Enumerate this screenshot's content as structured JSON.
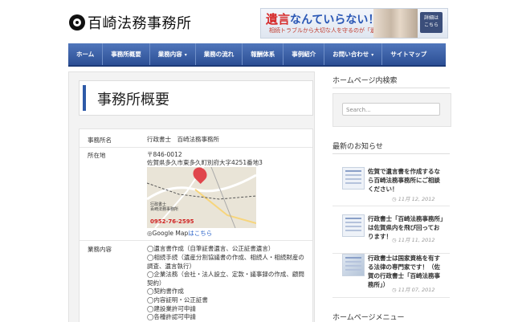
{
  "site": {
    "title": "百崎法務事務所"
  },
  "banner": {
    "main_red": "遺言",
    "main_blue": "なんていらない！？",
    "sub": "相続トラブルから大切な人を守るのが「遺言」です。",
    "button": "詳細は\nこちら"
  },
  "nav": {
    "items": [
      {
        "label": "ホーム"
      },
      {
        "label": "事務所概要"
      },
      {
        "label": "業務内容",
        "caret": "▾"
      },
      {
        "label": "業務の流れ"
      },
      {
        "label": "報酬体系"
      },
      {
        "label": "事例紹介"
      },
      {
        "label": "お問い合わせ",
        "caret": "▾"
      },
      {
        "label": "サイトマップ"
      }
    ]
  },
  "page": {
    "title": "事務所概要"
  },
  "info": {
    "name_label": "事務所名",
    "name_value": "行政書士　百崎法務事務所",
    "address_label": "所在地",
    "postal": "〒846-0012",
    "address": "佐賀県多久市東多久町別府大字4251番地3",
    "map_caption": "行政書士\n百崎法務事務所",
    "map_tel": "0952-76-2595",
    "map_link_prefix": "◎Google Map",
    "map_link_text": "はこちら",
    "services_label": "業務内容",
    "services": [
      "◯遺言書作成（自筆証書遺言、公正証書遺言）",
      "◯相続手続（遺産分割協議書の作成、相続人・相続財産の調査、遺言執行）",
      "◯企業法務（会社・法人設立、定款・議事録の作成、顧問契約）",
      "◯契約書作成",
      "◯内容証明・公正証書",
      "◯建設業許可申請",
      "◯各種許認可申請"
    ]
  },
  "sidebar": {
    "search_heading": "ホームページ内検索",
    "search_placeholder": "Search...",
    "news_heading": "最新のお知らせ",
    "news": [
      {
        "title": "佐賀で遺言書を作成するなら百崎法務事務所にご相談ください！",
        "date": "11月 12, 2012"
      },
      {
        "title": "行政書士「百崎法務事務所」は佐賀県内を飛び回っております！",
        "date": "11月 11, 2012"
      },
      {
        "title": "行政書士は国家資格を有する法律の専門家です！（佐賀の行政書士「百崎法務事務所」）",
        "date": "11月 07, 2012"
      }
    ],
    "menu_heading": "ホームページメニュー"
  },
  "colors": {
    "nav": "#3a5fa8",
    "accent": "#2e5aa8",
    "banner_red": "#d62d2d"
  }
}
